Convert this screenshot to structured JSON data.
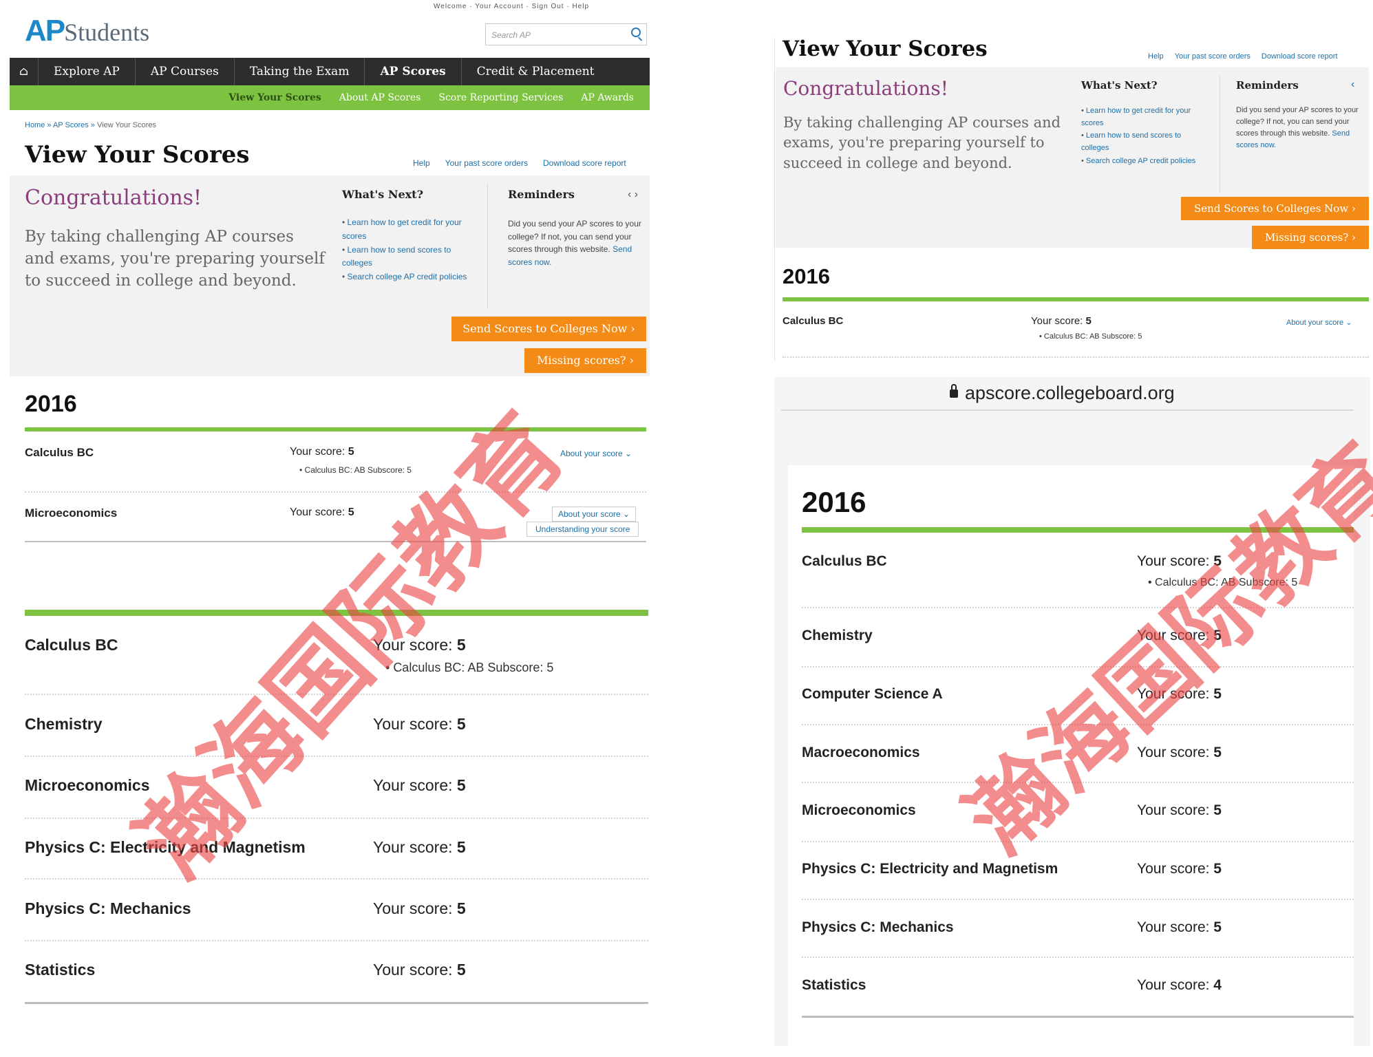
{
  "left": {
    "logo": {
      "ap": "AP",
      "students": "Students"
    },
    "top_links": "Welcome  ·  Your Account  ·  Sign Out  ·  Help",
    "search_placeholder": "Search AP",
    "nav": [
      "Explore AP",
      "AP Courses",
      "Taking the Exam",
      "AP Scores",
      "Credit & Placement"
    ],
    "subnav": [
      "View Your Scores",
      "About AP Scores",
      "Score Reporting Services",
      "AP Awards"
    ],
    "breadcrumb": [
      "Home",
      "AP Scores",
      "View Your Scores"
    ],
    "title": "View Your Scores",
    "toolbar_links": [
      "Help",
      "Your past score orders",
      "Download score report"
    ],
    "congrats": "Congratulations!",
    "hero_body": "By taking challenging AP courses and exams, you're preparing yourself to succeed in college and beyond.",
    "whats_next": {
      "title": "What's Next?",
      "items": [
        "Learn how to get credit for your scores",
        "Learn how to send scores to colleges",
        "Search college AP credit policies"
      ]
    },
    "reminders": {
      "title": "Reminders",
      "arrows": "‹ ›",
      "body": "Did you send your AP scores to your college? If not, you can send your scores through this website.",
      "link": "Send scores now."
    },
    "send_btn": "Send Scores to Colleges Now ›",
    "missing_btn": "Missing scores? ›",
    "year": "2016",
    "summary_rows": [
      {
        "name": "Calculus BC",
        "score_label": "Your score:",
        "score": "5",
        "sub": "Calculus BC: AB Subscore: 5",
        "about": "About your score ⌄"
      },
      {
        "name": "Microeconomics",
        "score_label": "Your score:",
        "score": "5",
        "about": "About your score ⌄",
        "understanding": "Understanding your score"
      }
    ],
    "rows": [
      {
        "name": "Calculus BC",
        "score_label": "Your score:",
        "score": "5",
        "sub": "Calculus BC: AB Subscore: 5"
      },
      {
        "name": "Chemistry",
        "score_label": "Your score:",
        "score": "5"
      },
      {
        "name": "Microeconomics",
        "score_label": "Your score:",
        "score": "5"
      },
      {
        "name": "Physics C: Electricity and Magnetism",
        "score_label": "Your score:",
        "score": "5"
      },
      {
        "name": "Physics C: Mechanics",
        "score_label": "Your score:",
        "score": "5"
      },
      {
        "name": "Statistics",
        "score_label": "Your score:",
        "score": "5"
      }
    ]
  },
  "right": {
    "title": "View Your Scores",
    "toolbar_links": [
      "Help",
      "Your past score orders",
      "Download score report"
    ],
    "congrats": "Congratulations!",
    "hero_body": "By taking challenging AP courses and exams, you're preparing yourself to succeed in college and beyond.",
    "whats_next": {
      "title": "What's Next?",
      "items": [
        "Learn how to get credit for your scores",
        "Learn how to send scores to colleges",
        "Search college AP credit policies"
      ]
    },
    "reminders": {
      "title": "Reminders",
      "arrow": "‹",
      "body": "Did you send your AP scores to your college? If not, you can send your scores through this website.",
      "link": "Send scores now."
    },
    "send_btn": "Send Scores to Colleges Now ›",
    "missing_btn": "Missing scores? ›",
    "year_top": "2016",
    "top_row": {
      "name": "Calculus BC",
      "score_label": "Your score:",
      "score": "5",
      "sub": "Calculus BC: AB Subscore: 5",
      "about": "About your score ⌄"
    },
    "url": "apscore.collegeboard.org",
    "year": "2016",
    "rows": [
      {
        "name": "Calculus BC",
        "score_label": "Your score:",
        "score": "5",
        "sub": "Calculus BC: AB Subscore: 5"
      },
      {
        "name": "Chemistry",
        "score_label": "Your score:",
        "score": "5"
      },
      {
        "name": "Computer Science A",
        "score_label": "Your score:",
        "score": "5"
      },
      {
        "name": "Macroeconomics",
        "score_label": "Your score:",
        "score": "5"
      },
      {
        "name": "Microeconomics",
        "score_label": "Your score:",
        "score": "5"
      },
      {
        "name": "Physics C: Electricity and Magnetism",
        "score_label": "Your score:",
        "score": "5"
      },
      {
        "name": "Physics C: Mechanics",
        "score_label": "Your score:",
        "score": "5"
      },
      {
        "name": "Statistics",
        "score_label": "Your score:",
        "score": "4"
      }
    ]
  },
  "watermark": "瀚海国际教育",
  "colors": {
    "nav": "#2d2d2d",
    "green": "#7dc241",
    "orange": "#f38b16",
    "purple": "#8a3d7a",
    "link": "#1c6fa8",
    "watermark": "#eb4646"
  }
}
